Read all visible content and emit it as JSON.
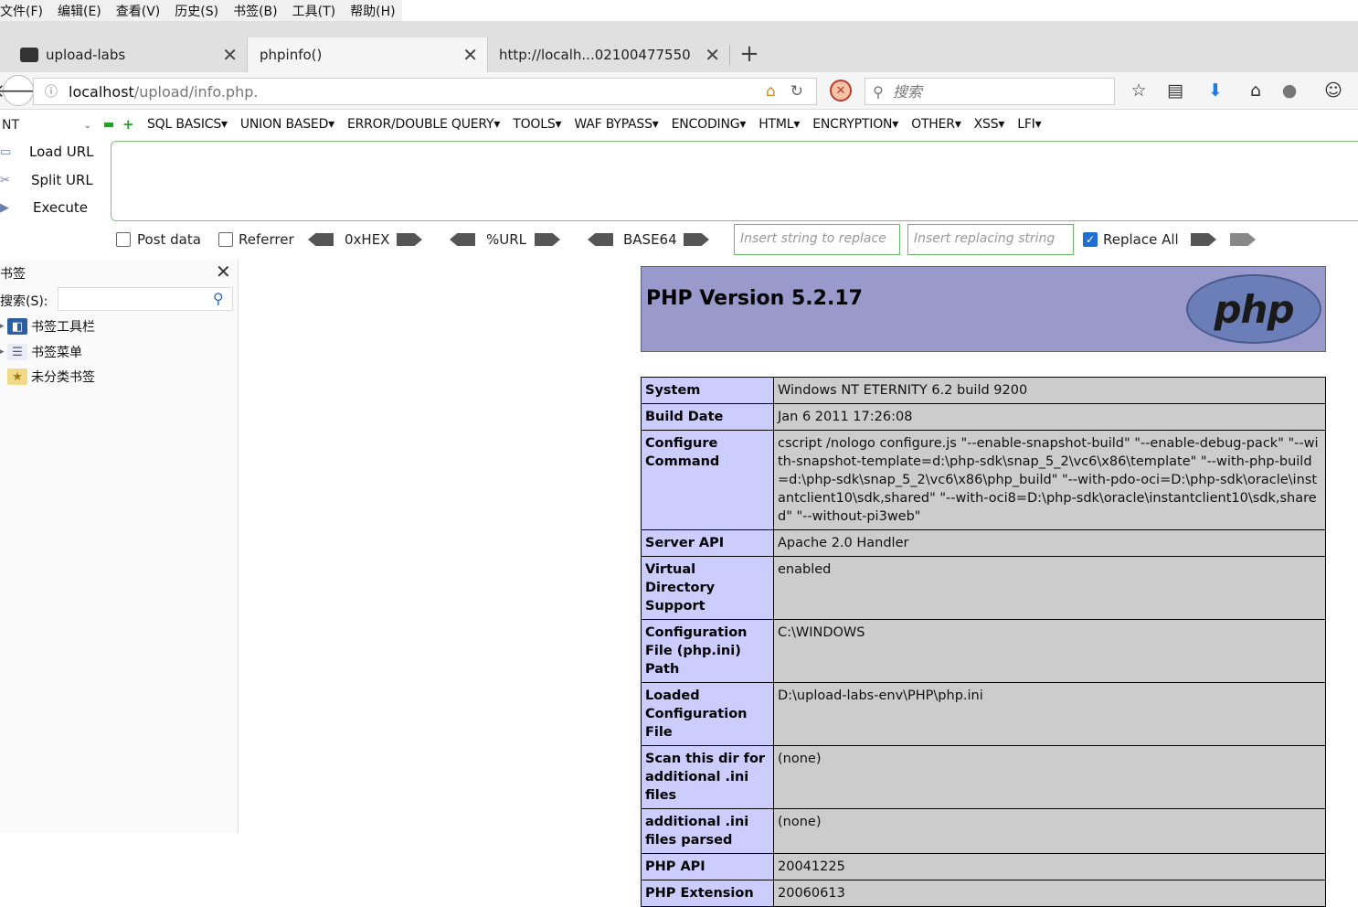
{
  "menubar": [
    "文件(F)",
    "编辑(E)",
    "查看(V)",
    "历史(S)",
    "书签(B)",
    "工具(T)",
    "帮助(H)"
  ],
  "tabs": [
    {
      "title": "upload-labs",
      "active": false
    },
    {
      "title": "phpinfo()",
      "active": true
    },
    {
      "title": "http://localh...02100477550.",
      "active": false
    }
  ],
  "navbar": {
    "url_host": "localhost",
    "url_path": "/upload/info.php.",
    "search_placeholder": "搜索"
  },
  "hackbar": {
    "select_value": "NT",
    "menus": [
      "SQL BASICS",
      "UNION BASED",
      "ERROR/DOUBLE QUERY",
      "TOOLS",
      "WAF BYPASS",
      "ENCODING",
      "HTML",
      "ENCRYPTION",
      "OTHER",
      "XSS",
      "LFI"
    ],
    "actions": [
      "Load URL",
      "Split URL",
      "Execute"
    ],
    "post_data_label": "Post data",
    "referrer_label": "Referrer",
    "hex_label": "0xHEX",
    "url_label": "%URL",
    "base64_label": "BASE64",
    "replace_placeholder": "Insert string to replace",
    "replacing_placeholder": "Insert replacing string",
    "replace_all_label": "Replace All",
    "replace_all_checked": true
  },
  "sidebar": {
    "title": "书签",
    "search_label": "搜索(S):",
    "items": [
      "书签工具栏",
      "书签菜单",
      "未分类书签"
    ]
  },
  "phpinfo": {
    "version": "PHP Version 5.2.17",
    "logo_text": "php",
    "rows": [
      {
        "key": "System",
        "value": "Windows NT ETERNITY 6.2 build 9200"
      },
      {
        "key": "Build Date",
        "value": "Jan 6 2011 17:26:08"
      },
      {
        "key": "Configure Command",
        "value": "cscript /nologo configure.js \"--enable-snapshot-build\" \"--enable-debug-pack\" \"--with-snapshot-template=d:\\php-sdk\\snap_5_2\\vc6\\x86\\template\" \"--with-php-build=d:\\php-sdk\\snap_5_2\\vc6\\x86\\php_build\" \"--with-pdo-oci=D:\\php-sdk\\oracle\\instantclient10\\sdk,shared\" \"--with-oci8=D:\\php-sdk\\oracle\\instantclient10\\sdk,shared\" \"--without-pi3web\""
      },
      {
        "key": "Server API",
        "value": "Apache 2.0 Handler"
      },
      {
        "key": "Virtual Directory Support",
        "value": "enabled"
      },
      {
        "key": "Configuration File (php.ini) Path",
        "value": "C:\\WINDOWS"
      },
      {
        "key": "Loaded Configuration File",
        "value": "D:\\upload-labs-env\\PHP\\php.ini"
      },
      {
        "key": "Scan this dir for additional .ini files",
        "value": "(none)"
      },
      {
        "key": "additional .ini files parsed",
        "value": "(none)"
      },
      {
        "key": "PHP API",
        "value": "20041225"
      },
      {
        "key": "PHP Extension",
        "value": "20060613"
      }
    ]
  },
  "colors": {
    "php_header_bg": "#9999cc",
    "php_key_bg": "#ccccff",
    "php_value_bg": "#cccccc",
    "hackbar_border": "#7fbf7f"
  }
}
